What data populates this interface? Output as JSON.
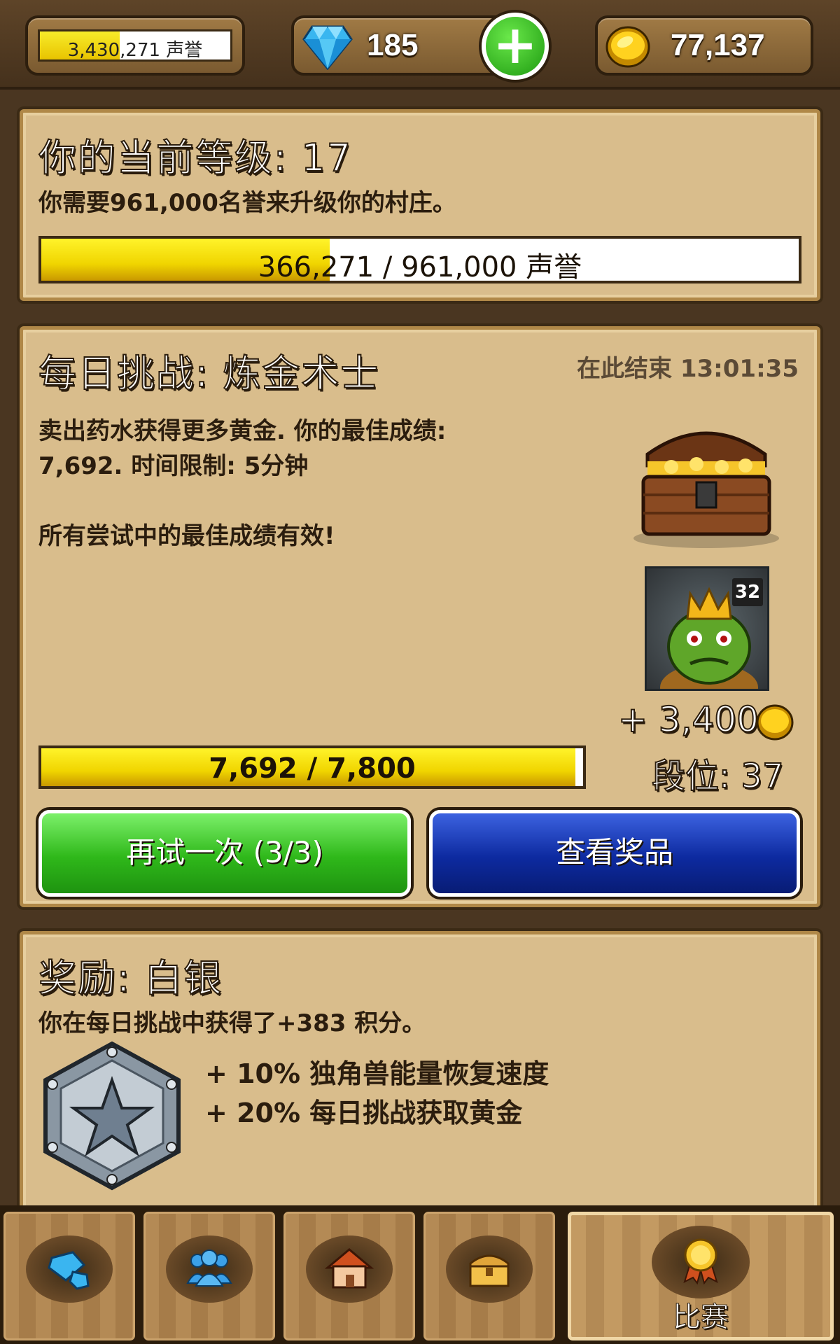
{
  "topbar": {
    "fame_text": "3,430,271 声誉",
    "fame_fill": 0.42,
    "gems": "185",
    "gold": "77,137"
  },
  "level": {
    "title": "你的当前等级: 17",
    "description": "你需要961,000名誉来升级你的村庄。",
    "progress_text": "366,271 / 961,000 声誉",
    "progress_value": 366271,
    "progress_max": 961000
  },
  "challenge": {
    "title": "每日挑战: 炼金术士",
    "ends": "在此结束 13:01:35",
    "desc_line1": "卖出药水获得更多黄金. 你的最佳成绩:",
    "desc_line2": "7,692. 时间限制: 5分钟",
    "note": "所有尝试中的最佳成绩有效!",
    "avatar_level": "32",
    "reward": "+ 3,400",
    "rank": "段位: 37",
    "progress_text": "7,692 / 7,800",
    "progress_value": 7692,
    "progress_max": 7800,
    "retry_button": "再试一次 (3/3)",
    "prizes_button": "查看奖品"
  },
  "rewards": {
    "title": "奖励: 白银",
    "points": "你在每日挑战中获得了+383 积分。",
    "bonus1": "+ 10% 独角兽能量恢复速度",
    "bonus2": "+ 20% 每日挑战获取黄金"
  },
  "nav": {
    "active_label": "比赛",
    "items": [
      "gem-icon",
      "people-icon",
      "house-icon",
      "chest-icon",
      "medal-icon"
    ]
  },
  "colors": {
    "progress_yellow": "#f0d500",
    "green_button": "#2fb81a",
    "blue_button": "#0d2aa0",
    "panel": "#d9bd8c"
  }
}
